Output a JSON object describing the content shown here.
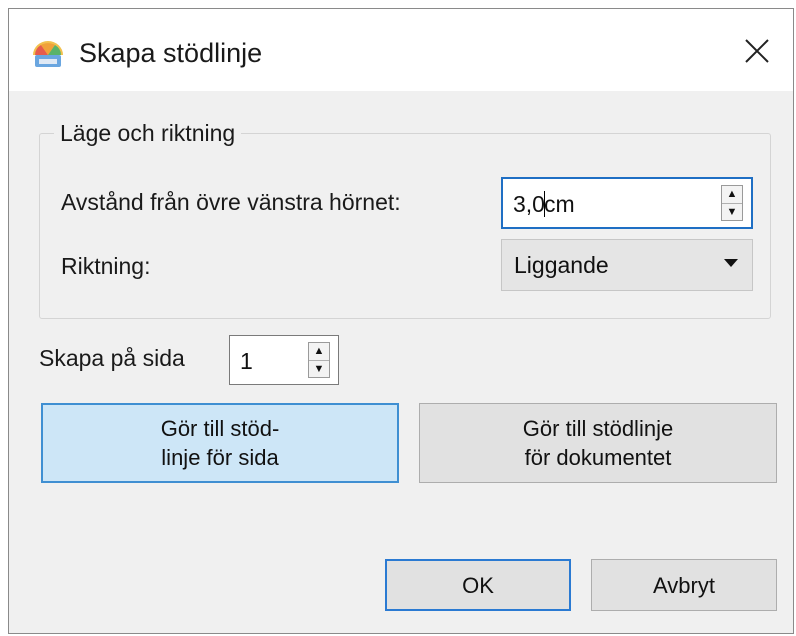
{
  "dialog": {
    "title": "Skapa stödlinje",
    "close_icon": "close-icon",
    "app_icon": "palette-app-icon"
  },
  "group": {
    "title": "Läge och riktning",
    "distance_label": "Avstånd från övre vänstra hörnet:",
    "distance_value_before_caret": "3,0",
    "distance_value_after_caret": "cm",
    "direction_label": "Riktning:",
    "direction_value": "Liggande"
  },
  "page": {
    "label": "Skapa på sida",
    "value": "1"
  },
  "buttons": {
    "page_guide_line1": "Gör till stöd-",
    "page_guide_line2": "linje för sida",
    "doc_guide_line1": "Gör till stödlinje",
    "doc_guide_line2": "för dokumentet",
    "ok": "OK",
    "cancel": "Avbryt"
  },
  "colors": {
    "focus_border": "#1f6fc4",
    "hover_button_bg": "#cde6f7",
    "dialog_bg": "#f0f0f0"
  }
}
